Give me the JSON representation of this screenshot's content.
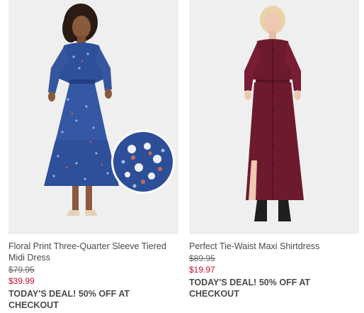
{
  "products": [
    {
      "name": "Floral Print Three-Quarter Sleeve Tiered Midi Dress",
      "original_price": "$79.95",
      "sale_price": "$39.99",
      "deal": "TODAY'S DEAL! 50% OFF AT CHECKOUT",
      "image": "model-in-blue-floral-dress-with-detail-swatch"
    },
    {
      "name": "Perfect Tie-Waist Maxi Shirtdress",
      "original_price": "$89.95",
      "sale_price": "$19.97",
      "deal": "TODAY'S DEAL! 50% OFF AT CHECKOUT",
      "image": "model-in-burgundy-maxi-shirtdress"
    }
  ],
  "colors": {
    "sale_price": "#c4122e",
    "text": "#4a4a4a",
    "image_bg": "#efefef"
  }
}
